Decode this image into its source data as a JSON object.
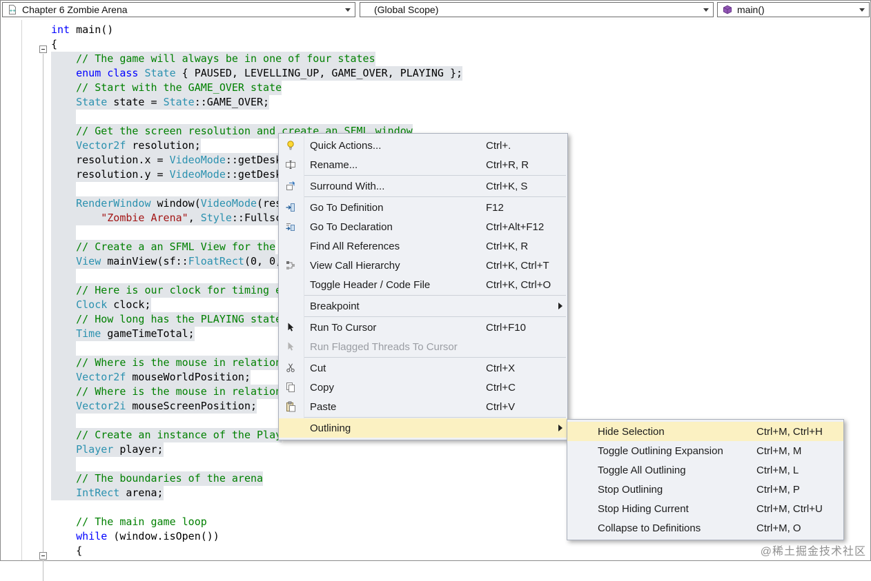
{
  "topbar": {
    "file_dropdown": {
      "label": "Chapter 6 Zombie Arena",
      "icon": "cpp-file-icon"
    },
    "scope_dropdown": {
      "label": "(Global Scope)"
    },
    "member_dropdown": {
      "label": "main()",
      "icon": "method-icon"
    }
  },
  "editor": {
    "lines": [
      {
        "indent": 0,
        "selected": false,
        "tokens": [
          [
            "k",
            "int"
          ],
          [
            "p",
            " main()"
          ]
        ]
      },
      {
        "indent": 0,
        "selected": false,
        "tokens": [
          [
            "p",
            "{"
          ]
        ]
      },
      {
        "indent": 1,
        "selected": true,
        "tokens": [
          [
            "c",
            "// The game will always be in one of four states"
          ]
        ]
      },
      {
        "indent": 1,
        "selected": true,
        "tokens": [
          [
            "k",
            "enum"
          ],
          [
            "p",
            " "
          ],
          [
            "k",
            "class"
          ],
          [
            "p",
            " "
          ],
          [
            "t",
            "State"
          ],
          [
            "p",
            " { PAUSED, LEVELLING_UP, GAME_OVER, PLAYING };"
          ]
        ]
      },
      {
        "indent": 1,
        "selected": true,
        "tokens": [
          [
            "c",
            "// Start with the GAME_OVER state"
          ]
        ]
      },
      {
        "indent": 1,
        "selected": true,
        "tokens": [
          [
            "t",
            "State"
          ],
          [
            "p",
            " state = "
          ],
          [
            "t",
            "State"
          ],
          [
            "p",
            "::GAME_OVER;"
          ]
        ]
      },
      {
        "indent": 1,
        "selected": true,
        "tokens": []
      },
      {
        "indent": 1,
        "selected": true,
        "tokens": [
          [
            "c",
            "// Get the screen resolution and create an SFML window"
          ]
        ]
      },
      {
        "indent": 1,
        "selected": true,
        "tokens": [
          [
            "t",
            "Vector2f"
          ],
          [
            "p",
            " resolution;"
          ]
        ]
      },
      {
        "indent": 1,
        "selected": true,
        "tokens": [
          [
            "p",
            "resolution.x = "
          ],
          [
            "t",
            "VideoMode"
          ],
          [
            "p",
            "::getDesk"
          ]
        ]
      },
      {
        "indent": 1,
        "selected": true,
        "tokens": [
          [
            "p",
            "resolution.y = "
          ],
          [
            "t",
            "VideoMode"
          ],
          [
            "p",
            "::getDesk"
          ]
        ]
      },
      {
        "indent": 1,
        "selected": true,
        "tokens": []
      },
      {
        "indent": 1,
        "selected": true,
        "tokens": [
          [
            "t",
            "RenderWindow"
          ],
          [
            "p",
            " window("
          ],
          [
            "t",
            "VideoMode"
          ],
          [
            "p",
            "(res"
          ]
        ]
      },
      {
        "indent": 2,
        "selected": true,
        "tokens": [
          [
            "s",
            "\"Zombie Arena\""
          ],
          [
            "p",
            ", "
          ],
          [
            "t",
            "Style"
          ],
          [
            "p",
            "::Fullsc"
          ]
        ]
      },
      {
        "indent": 1,
        "selected": true,
        "tokens": []
      },
      {
        "indent": 1,
        "selected": true,
        "tokens": [
          [
            "c",
            "// Create a an SFML View for the"
          ]
        ]
      },
      {
        "indent": 1,
        "selected": true,
        "tokens": [
          [
            "t",
            "View"
          ],
          [
            "p",
            " mainView(sf::"
          ],
          [
            "t",
            "FloatRect"
          ],
          [
            "p",
            "(0, 0,"
          ]
        ]
      },
      {
        "indent": 1,
        "selected": true,
        "tokens": []
      },
      {
        "indent": 1,
        "selected": true,
        "tokens": [
          [
            "c",
            "// Here is our clock for timing e"
          ]
        ]
      },
      {
        "indent": 1,
        "selected": true,
        "tokens": [
          [
            "t",
            "Clock"
          ],
          [
            "p",
            " clock;"
          ]
        ]
      },
      {
        "indent": 1,
        "selected": true,
        "tokens": [
          [
            "c",
            "// How long has the PLAYING state"
          ]
        ]
      },
      {
        "indent": 1,
        "selected": true,
        "tokens": [
          [
            "t",
            "Time"
          ],
          [
            "p",
            " gameTimeTotal;"
          ]
        ]
      },
      {
        "indent": 1,
        "selected": true,
        "tokens": []
      },
      {
        "indent": 1,
        "selected": true,
        "tokens": [
          [
            "c",
            "// Where is the mouse in relation"
          ]
        ]
      },
      {
        "indent": 1,
        "selected": true,
        "tokens": [
          [
            "t",
            "Vector2f"
          ],
          [
            "p",
            " mouseWorldPosition;"
          ]
        ]
      },
      {
        "indent": 1,
        "selected": true,
        "tokens": [
          [
            "c",
            "// Where is the mouse in relation"
          ]
        ]
      },
      {
        "indent": 1,
        "selected": true,
        "tokens": [
          [
            "t",
            "Vector2i"
          ],
          [
            "p",
            " mouseScreenPosition;"
          ]
        ]
      },
      {
        "indent": 1,
        "selected": true,
        "tokens": []
      },
      {
        "indent": 1,
        "selected": true,
        "tokens": [
          [
            "c",
            "// Create an instance of the Play"
          ]
        ]
      },
      {
        "indent": 1,
        "selected": true,
        "tokens": [
          [
            "t",
            "Player"
          ],
          [
            "p",
            " player;"
          ]
        ]
      },
      {
        "indent": 1,
        "selected": true,
        "tokens": []
      },
      {
        "indent": 1,
        "selected": true,
        "tokens": [
          [
            "c",
            "// The boundaries of the arena"
          ]
        ]
      },
      {
        "indent": 1,
        "selected": true,
        "tokens": [
          [
            "t",
            "IntRect"
          ],
          [
            "p",
            " arena;"
          ]
        ]
      },
      {
        "indent": 1,
        "selected": false,
        "tokens": []
      },
      {
        "indent": 1,
        "selected": false,
        "tokens": [
          [
            "c",
            "// The main game loop"
          ]
        ]
      },
      {
        "indent": 1,
        "selected": false,
        "tokens": [
          [
            "k",
            "while"
          ],
          [
            "p",
            " (window.isOpen())"
          ]
        ]
      },
      {
        "indent": 1,
        "selected": false,
        "tokens": [
          [
            "p",
            "{"
          ]
        ]
      }
    ]
  },
  "context_menu": {
    "items": [
      {
        "label": "Quick Actions...",
        "shortcut": "Ctrl+.",
        "icon": "lightbulb-icon"
      },
      {
        "label": "Rename...",
        "shortcut": "Ctrl+R, R",
        "icon": "rename-icon"
      },
      {
        "type": "separator"
      },
      {
        "label": "Surround With...",
        "shortcut": "Ctrl+K, S",
        "icon": "surround-with-icon"
      },
      {
        "type": "separator"
      },
      {
        "label": "Go To Definition",
        "shortcut": "F12",
        "icon": "goto-definition-icon"
      },
      {
        "label": "Go To Declaration",
        "shortcut": "Ctrl+Alt+F12",
        "icon": "goto-declaration-icon"
      },
      {
        "label": "Find All References",
        "shortcut": "Ctrl+K, R"
      },
      {
        "label": "View Call Hierarchy",
        "shortcut": "Ctrl+K, Ctrl+T",
        "icon": "call-hierarchy-icon"
      },
      {
        "label": "Toggle Header / Code File",
        "shortcut": "Ctrl+K, Ctrl+O"
      },
      {
        "type": "separator"
      },
      {
        "label": "Breakpoint",
        "submenu": true
      },
      {
        "type": "separator"
      },
      {
        "label": "Run To Cursor",
        "shortcut": "Ctrl+F10",
        "icon": "run-to-cursor-icon"
      },
      {
        "label": "Run Flagged Threads To Cursor",
        "disabled": true,
        "icon": "run-flagged-icon"
      },
      {
        "type": "separator"
      },
      {
        "label": "Cut",
        "shortcut": "Ctrl+X",
        "icon": "cut-icon"
      },
      {
        "label": "Copy",
        "shortcut": "Ctrl+C",
        "icon": "copy-icon"
      },
      {
        "label": "Paste",
        "shortcut": "Ctrl+V",
        "icon": "paste-icon"
      },
      {
        "type": "separator"
      },
      {
        "label": "Outlining",
        "submenu": true,
        "highlighted": true
      }
    ]
  },
  "outlining_submenu": {
    "items": [
      {
        "label": "Hide Selection",
        "shortcut": "Ctrl+M, Ctrl+H",
        "highlighted": true
      },
      {
        "label": "Toggle Outlining Expansion",
        "shortcut": "Ctrl+M, M"
      },
      {
        "label": "Toggle All Outlining",
        "shortcut": "Ctrl+M, L"
      },
      {
        "label": "Stop Outlining",
        "shortcut": "Ctrl+M, P"
      },
      {
        "label": "Stop Hiding Current",
        "shortcut": "Ctrl+M, Ctrl+U"
      },
      {
        "label": "Collapse to Definitions",
        "shortcut": "Ctrl+M, O"
      }
    ]
  },
  "watermark": "@稀土掘金技术社区",
  "colors": {
    "selection_band": "#e2e5e9",
    "menu_background": "#eff1f5",
    "menu_highlight": "#fbf1c2",
    "keyword": "#0000ff",
    "type": "#2b91af",
    "comment": "#008000",
    "string": "#a31515"
  }
}
